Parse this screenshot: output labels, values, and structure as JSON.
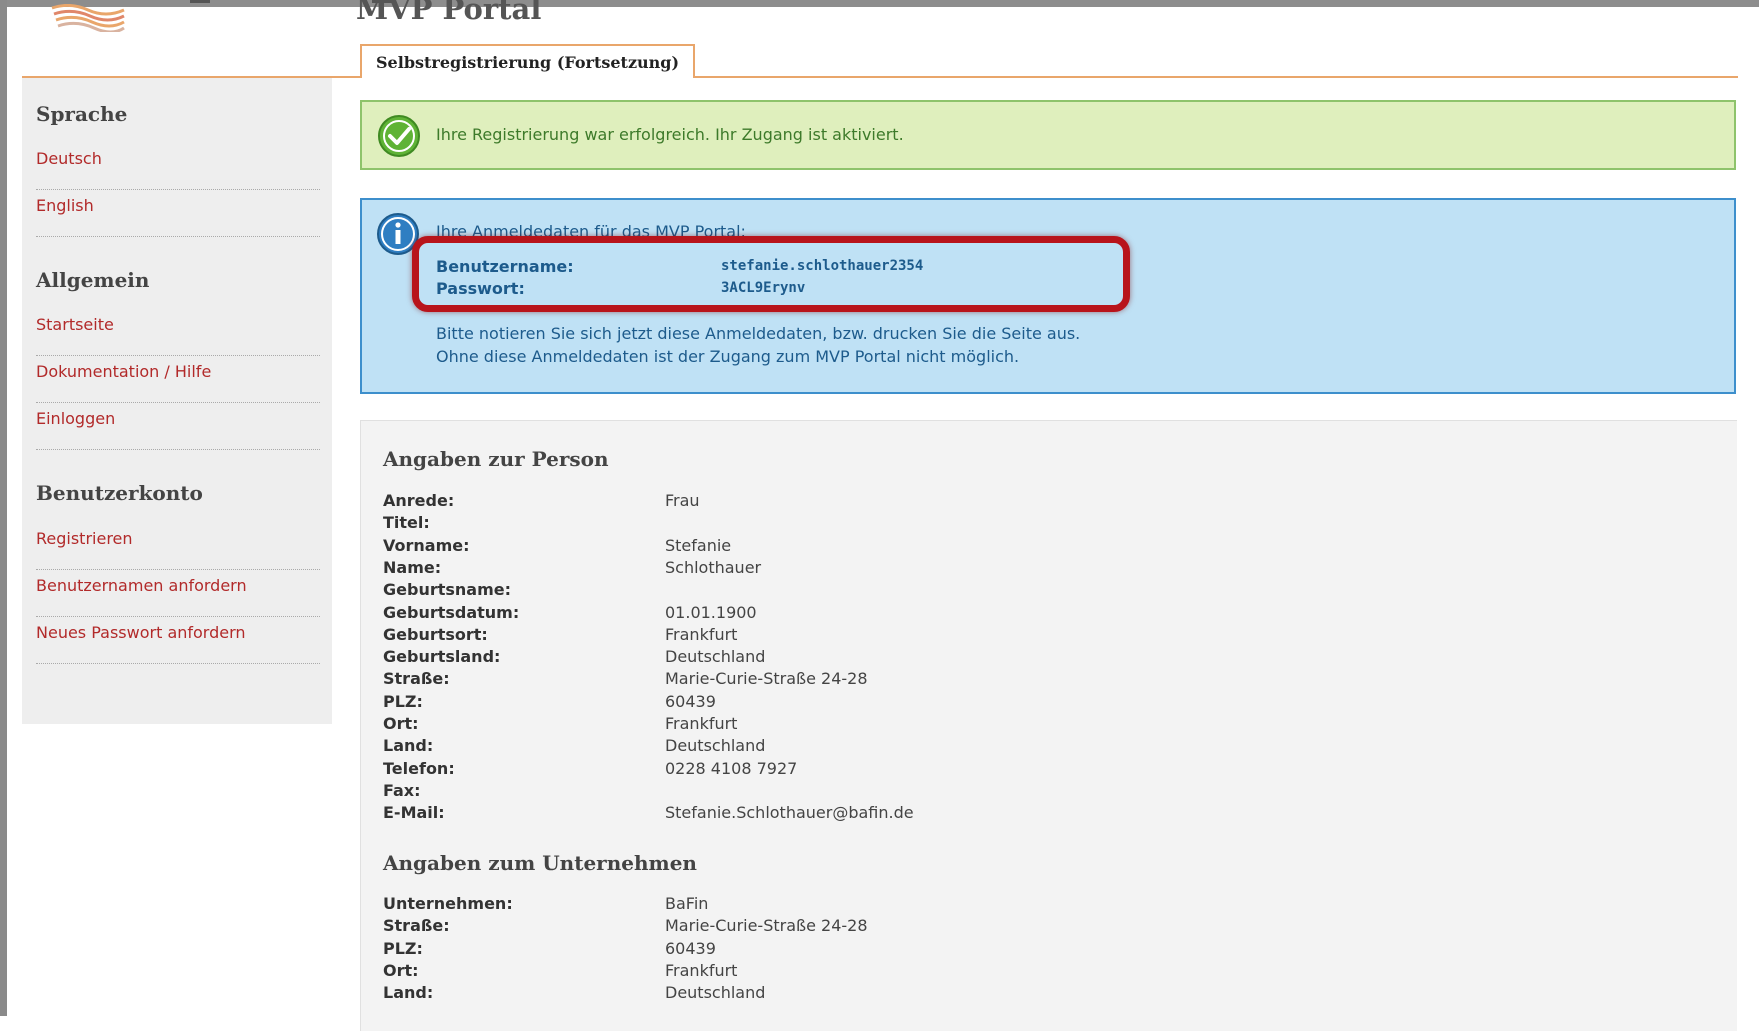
{
  "app": {
    "title": "MVP Portal"
  },
  "tab": {
    "label": "Selbstregistrierung (Fortsetzung)"
  },
  "sidebar": {
    "sections": [
      {
        "heading": "Sprache",
        "items": [
          "Deutsch",
          "English"
        ]
      },
      {
        "heading": "Allgemein",
        "items": [
          "Startseite",
          "Dokumentation / Hilfe",
          "Einloggen"
        ]
      },
      {
        "heading": "Benutzerkonto",
        "items": [
          "Registrieren",
          "Benutzernamen anfordern",
          "Neues Passwort anfordern"
        ]
      }
    ]
  },
  "success": {
    "message": "Ihre Registrierung war erfolgreich. Ihr Zugang ist aktiviert.",
    "icon": "check-icon"
  },
  "info": {
    "icon": "info-icon",
    "intro": "Ihre Anmeldedaten für das MVP Portal:",
    "username_label": "Benutzername:",
    "username": "stefanie.schlothauer2354",
    "password_label": "Passwort:",
    "password": "3ACL9Erynv",
    "note_line1": "Bitte notieren Sie sich jetzt diese Anmeldedaten, bzw. drucken Sie die Seite aus.",
    "note_line2": "Ohne diese Anmeldedaten ist der Zugang zum MVP Portal nicht möglich."
  },
  "person": {
    "heading": "Angaben zur Person",
    "rows": [
      {
        "label": "Anrede:",
        "value": "Frau"
      },
      {
        "label": "Titel:",
        "value": ""
      },
      {
        "label": "Vorname:",
        "value": "Stefanie"
      },
      {
        "label": "Name:",
        "value": "Schlothauer"
      },
      {
        "label": "Geburtsname:",
        "value": ""
      },
      {
        "label": "Geburtsdatum:",
        "value": "01.01.1900"
      },
      {
        "label": "Geburtsort:",
        "value": "Frankfurt"
      },
      {
        "label": "Geburtsland:",
        "value": "Deutschland"
      },
      {
        "label": "Straße:",
        "value": "Marie-Curie-Straße 24-28"
      },
      {
        "label": "PLZ:",
        "value": "60439"
      },
      {
        "label": "Ort:",
        "value": "Frankfurt"
      },
      {
        "label": "Land:",
        "value": "Deutschland"
      },
      {
        "label": "Telefon:",
        "value": "0228 4108 7927"
      },
      {
        "label": "Fax:",
        "value": ""
      },
      {
        "label": "E-Mail:",
        "value": "Stefanie.Schlothauer@bafin.de"
      }
    ]
  },
  "company": {
    "heading": "Angaben zum Unternehmen",
    "rows": [
      {
        "label": "Unternehmen:",
        "value": "BaFin"
      },
      {
        "label": "Straße:",
        "value": "Marie-Curie-Straße 24-28"
      },
      {
        "label": "PLZ:",
        "value": "60439"
      },
      {
        "label": "Ort:",
        "value": "Frankfurt"
      },
      {
        "label": "Land:",
        "value": "Deutschland"
      }
    ]
  },
  "colors": {
    "accent": "#e9a66b",
    "link": "#b22a2a",
    "success_bg": "#dfefbd",
    "info_bg": "#bfe1f5",
    "highlight": "#b8141b"
  }
}
